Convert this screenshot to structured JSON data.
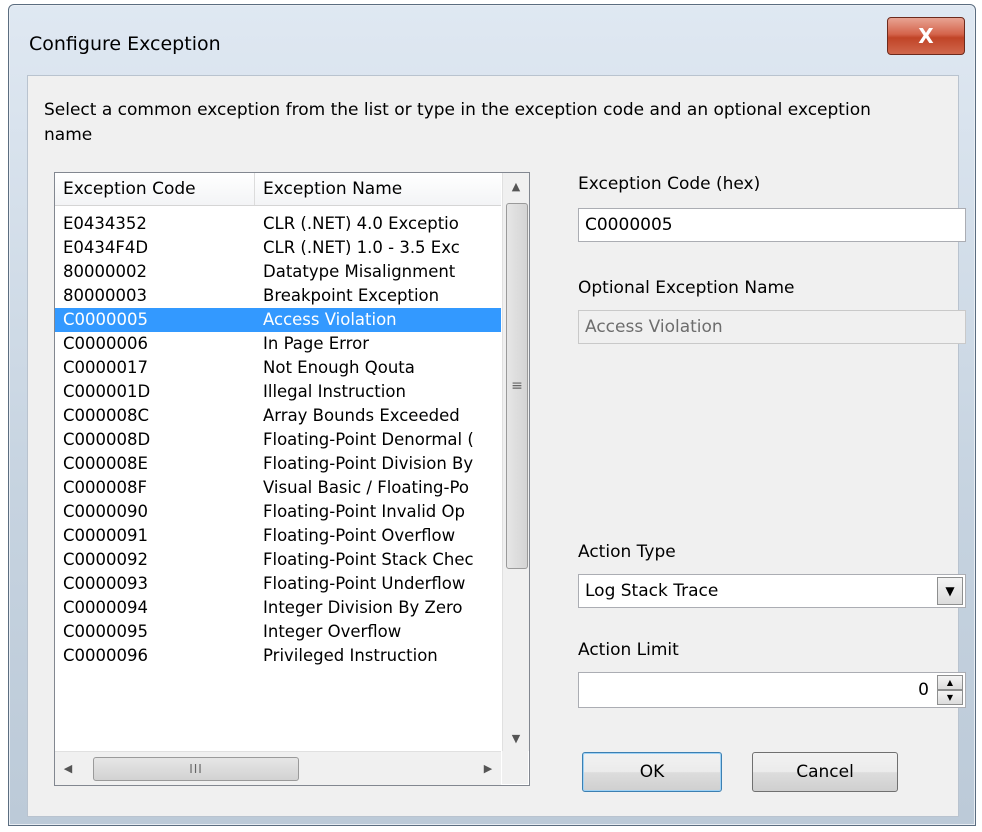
{
  "window": {
    "title": "Configure Exception",
    "close_glyph": "X"
  },
  "prompt": "Select a common exception from the list or type in the exception code and an optional exception name",
  "list": {
    "columns": [
      "Exception Code",
      "Exception Name"
    ],
    "selected_index": 4,
    "rows": [
      {
        "code": "E0434352",
        "name": "CLR (.NET) 4.0 Exceptio"
      },
      {
        "code": "E0434F4D",
        "name": "CLR (.NET) 1.0 - 3.5 Exc"
      },
      {
        "code": "80000002",
        "name": "Datatype Misalignment"
      },
      {
        "code": "80000003",
        "name": "Breakpoint Exception"
      },
      {
        "code": "C0000005",
        "name": "Access Violation"
      },
      {
        "code": "C0000006",
        "name": "In Page Error"
      },
      {
        "code": "C0000017",
        "name": "Not Enough Qouta"
      },
      {
        "code": "C000001D",
        "name": "Illegal Instruction"
      },
      {
        "code": "C000008C",
        "name": "Array Bounds Exceeded"
      },
      {
        "code": "C000008D",
        "name": "Floating-Point Denormal ("
      },
      {
        "code": "C000008E",
        "name": "Floating-Point Division By"
      },
      {
        "code": "C000008F",
        "name": "Visual Basic / Floating-Po"
      },
      {
        "code": "C0000090",
        "name": "Floating-Point Invalid Op"
      },
      {
        "code": "C0000091",
        "name": "Floating-Point Overflow"
      },
      {
        "code": "C0000092",
        "name": "Floating-Point Stack Chec"
      },
      {
        "code": "C0000093",
        "name": "Floating-Point Underflow"
      },
      {
        "code": "C0000094",
        "name": "Integer Division By Zero"
      },
      {
        "code": "C0000095",
        "name": "Integer Overflow"
      },
      {
        "code": "C0000096",
        "name": "Privileged Instruction"
      }
    ]
  },
  "form": {
    "code_label": "Exception Code (hex)",
    "code_value": "C0000005",
    "name_label": "Optional Exception Name",
    "name_value": "Access Violation",
    "action_type_label": "Action Type",
    "action_type_value": "Log Stack Trace",
    "action_limit_label": "Action Limit",
    "action_limit_value": "0"
  },
  "buttons": {
    "ok": "OK",
    "cancel": "Cancel"
  },
  "icons": {
    "close": "close-icon",
    "scroll_up": "arrow-up-icon",
    "scroll_down": "arrow-down-icon",
    "scroll_left": "arrow-left-icon",
    "scroll_right": "arrow-right-icon",
    "dropdown": "chevron-down-icon",
    "spin_up": "spin-up-icon",
    "spin_down": "spin-down-icon"
  },
  "colors": {
    "selection": "#3399ff",
    "close_button": "#c04427",
    "dialog_face": "#f0f0f0"
  }
}
